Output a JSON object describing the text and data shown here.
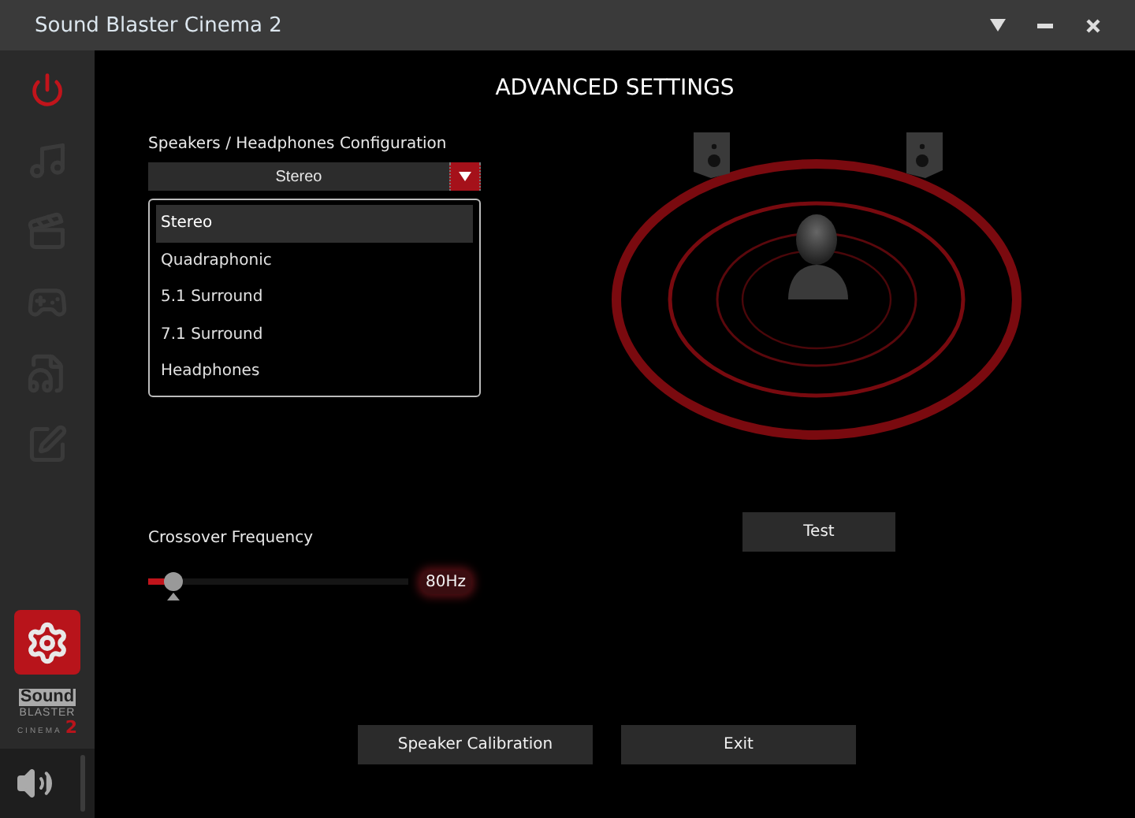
{
  "window": {
    "title": "Sound Blaster Cinema 2"
  },
  "sidebar": {
    "power": {
      "on": true
    },
    "items": [
      {
        "selected": false
      },
      {
        "selected": false
      },
      {
        "selected": false
      },
      {
        "selected": false
      },
      {
        "selected": false
      }
    ],
    "settings": {
      "selected": true
    },
    "logo": {
      "line1": "Sound",
      "line2": "BLASTER",
      "line3": "CINEMA",
      "edition": "2"
    }
  },
  "heading": "ADVANCED SETTINGS",
  "configuration": {
    "label": "Speakers / Headphones Configuration",
    "value": "Stereo",
    "options": [
      {
        "label": "Stereo",
        "selected": true
      },
      {
        "label": "Quadraphonic",
        "selected": false
      },
      {
        "label": "5.1 Surround",
        "selected": false
      },
      {
        "label": "7.1 Surround",
        "selected": false
      },
      {
        "label": "Headphones",
        "selected": false
      }
    ]
  },
  "crossover": {
    "label": "Crossover Frequency",
    "level": 0.1,
    "reading": "80Hz"
  },
  "test_button": "Test",
  "buttons": [
    "Speaker Calibration",
    "Exit"
  ]
}
